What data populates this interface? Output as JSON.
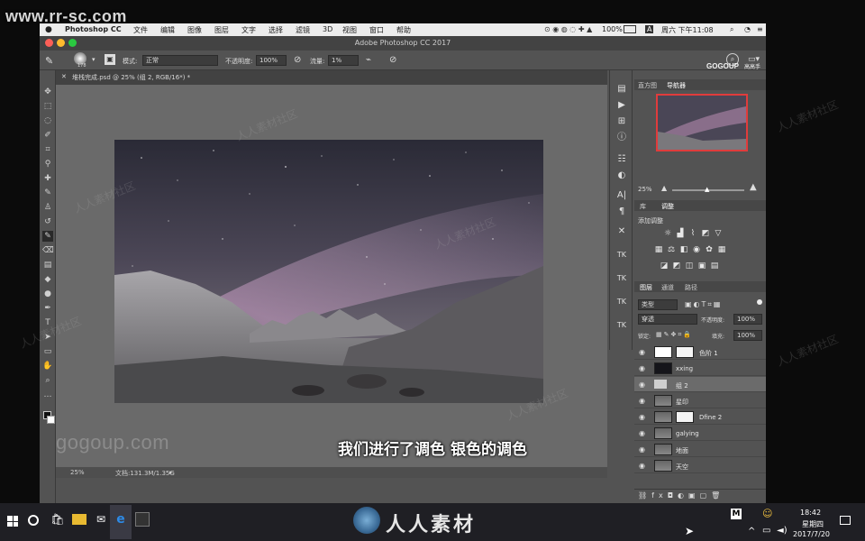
{
  "watermark": {
    "site": "www.rr-sc.com",
    "gogoup": "gogoup.com",
    "brand_title": "GOGOUP",
    "brand_sub": "高高手",
    "bottom_brand": "人人素材",
    "diag": "人人素材社区"
  },
  "menubar": {
    "apple": "",
    "items": [
      "Photoshop CC",
      "文件",
      "编辑",
      "图像",
      "图层",
      "文字",
      "选择",
      "滤镜",
      "3D",
      "视图",
      "窗口",
      "帮助"
    ],
    "battery": "100%",
    "day_time": "周六 下午11:08"
  },
  "titlebar": {
    "title": "Adobe Photoshop CC 2017"
  },
  "options": {
    "brush_size": "178",
    "mode_label": "模式:",
    "mode_value": "正常",
    "opacity_label": "不透明度:",
    "opacity_value": "100%",
    "flow_label": "流量:",
    "flow_value": "1%"
  },
  "document": {
    "tab_title": "堆栈完成.psd @ 25% (组 2, RGB/16*) *",
    "zoom": "25%",
    "doc_size": "文档:131.3M/1.35G"
  },
  "navigator": {
    "tabs": [
      "直方图",
      "导航器"
    ],
    "zoom": "25%"
  },
  "adjustments": {
    "tabs": [
      "库",
      "调整"
    ],
    "add_label": "添加调整"
  },
  "layers_panel": {
    "tabs": [
      "图层",
      "通道",
      "路径"
    ],
    "kind": "类型",
    "blend": "穿透",
    "opacity_label": "不透明度:",
    "opacity_value": "100%",
    "lock_label": "锁定:",
    "fill_label": "填充:",
    "fill_value": "100%",
    "layers": [
      {
        "name": "色阶 1",
        "kind": "adjustment"
      },
      {
        "name": "xxing",
        "kind": "dark"
      },
      {
        "name": "组 2",
        "kind": "group"
      },
      {
        "name": "星印",
        "kind": "photo"
      },
      {
        "name": "Dfine 2",
        "kind": "photo-mask"
      },
      {
        "name": "galying",
        "kind": "photo"
      },
      {
        "name": "地面",
        "kind": "photo"
      },
      {
        "name": "天空",
        "kind": "photo"
      }
    ]
  },
  "subtitle": "我们进行了调色 银色的调色",
  "taskbar": {
    "time": "18:42",
    "day": "星期四",
    "date": "2017/7/20",
    "ime": "M"
  },
  "colors": {
    "selected_layer": "#6b6b6b",
    "menubar_bg": "#ececec",
    "canvas_bg": "#6a6a6a"
  }
}
